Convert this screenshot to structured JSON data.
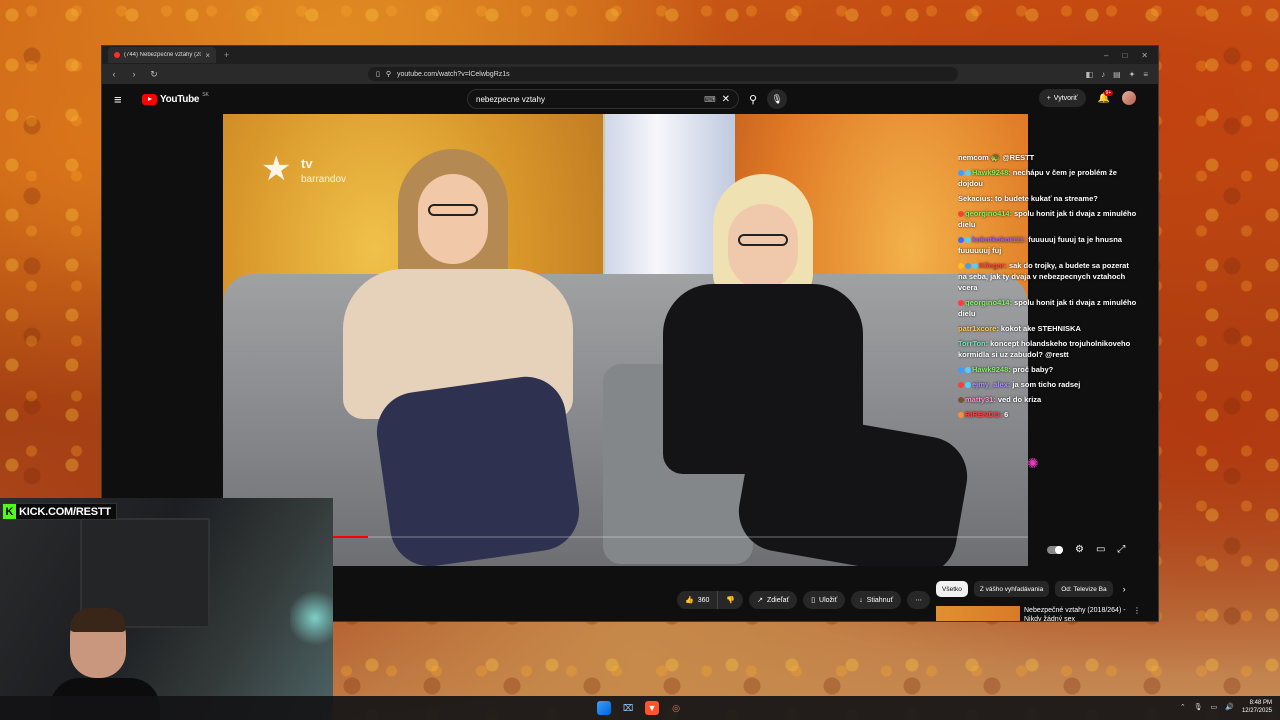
{
  "browser": {
    "tab_title": "(744) Nebezpečné vztahy (20",
    "url": "youtube.com/watch?v=lCelwbgRz1s"
  },
  "youtube": {
    "logo_text": "YouTube",
    "region": "SK",
    "search_query": "nebezpecne vztahy",
    "create_label": "Vytvoriť",
    "notif_count": "9+"
  },
  "video": {
    "channel_logo_tv": "tv",
    "channel_logo_brand": "barrandov",
    "progress": 0.18
  },
  "chat": {
    "messages": [
      {
        "user": "",
        "text": "nemcom 🐢 @RESTT",
        "color": "#ffffff",
        "badges": []
      },
      {
        "user": "Hawk9248",
        "text": "nechápu v čem je problém že dojdou",
        "color": "#7cf35a",
        "badges": [
          "#3aa0ff",
          "#4fd1ff"
        ]
      },
      {
        "user": "Sekacius",
        "text": "to budete kukať na streame?",
        "color": "#ffffff",
        "badges": []
      },
      {
        "user": "georgino414",
        "text": "spolu honit jak ti dvaja z minulého dielu",
        "color": "#7cf35a",
        "badges": [
          "#ff3b3b"
        ]
      },
      {
        "user": "kokotkokot111",
        "text": "fuuuuuj fuuuj ta je hnusna fuuuuuuj fuj",
        "color": "#9c5cff",
        "badges": [
          "#3a6bff",
          "#4fd1ff"
        ]
      },
      {
        "user": "Kilegar",
        "text": "sak do trojky, a budete sa pozerat na seba, jak ty dvaja v nebezpecnych vztahoch vcera",
        "color": "#ff3b3b",
        "badges": [
          "#ffbf1f",
          "#3aa0ff",
          "#4fd1ff"
        ]
      },
      {
        "user": "georgino414",
        "text": "spolu honit jak ti dvaja z minulého dielu",
        "color": "#7cf35a",
        "badges": [
          "#ff3b3b"
        ]
      },
      {
        "user": "patr1xcore",
        "text": "kokot ake STEHNISKA",
        "color": "#ffc94a",
        "badges": []
      },
      {
        "user": "TorrTon",
        "text": "koncept holandskeho trojuholnikoveho kormidla si uz zabudol? @restt",
        "color": "#6fe3b5",
        "badges": []
      },
      {
        "user": "Hawk9248",
        "text": "proč baby?",
        "color": "#7cf35a",
        "badges": [
          "#3aa0ff",
          "#4fd1ff"
        ]
      },
      {
        "user": "ejmy_alex",
        "text": "ja som ticho radsej",
        "color": "#a88cff",
        "badges": [
          "#ff3b3b",
          "#4fd1ff"
        ]
      },
      {
        "user": "matty31",
        "text": "ved do kriza",
        "color": "#ff8ac2",
        "badges": [
          "#7a5230"
        ]
      },
      {
        "user": "RIRENDO",
        "text": "6",
        "color": "#ff3b3b",
        "badges": [
          "#ff8a3a"
        ]
      }
    ]
  },
  "actions": {
    "like_count": "360",
    "share_label": "Zdieľať",
    "save_label": "Uložiť",
    "download_label": "Stiahnuť"
  },
  "sidebar": {
    "chips": [
      "Všetko",
      "Z vášho vyhľadávania",
      "Od: Televize Ba"
    ],
    "rec_title": "Nebezpečné vztahy (2018/264) - Nikdy žádný sex"
  },
  "overlay": {
    "kick_text": "KICK.COM/RESTT"
  },
  "taskbar": {
    "time": "8:48 PM",
    "date": "12/27/2025"
  }
}
